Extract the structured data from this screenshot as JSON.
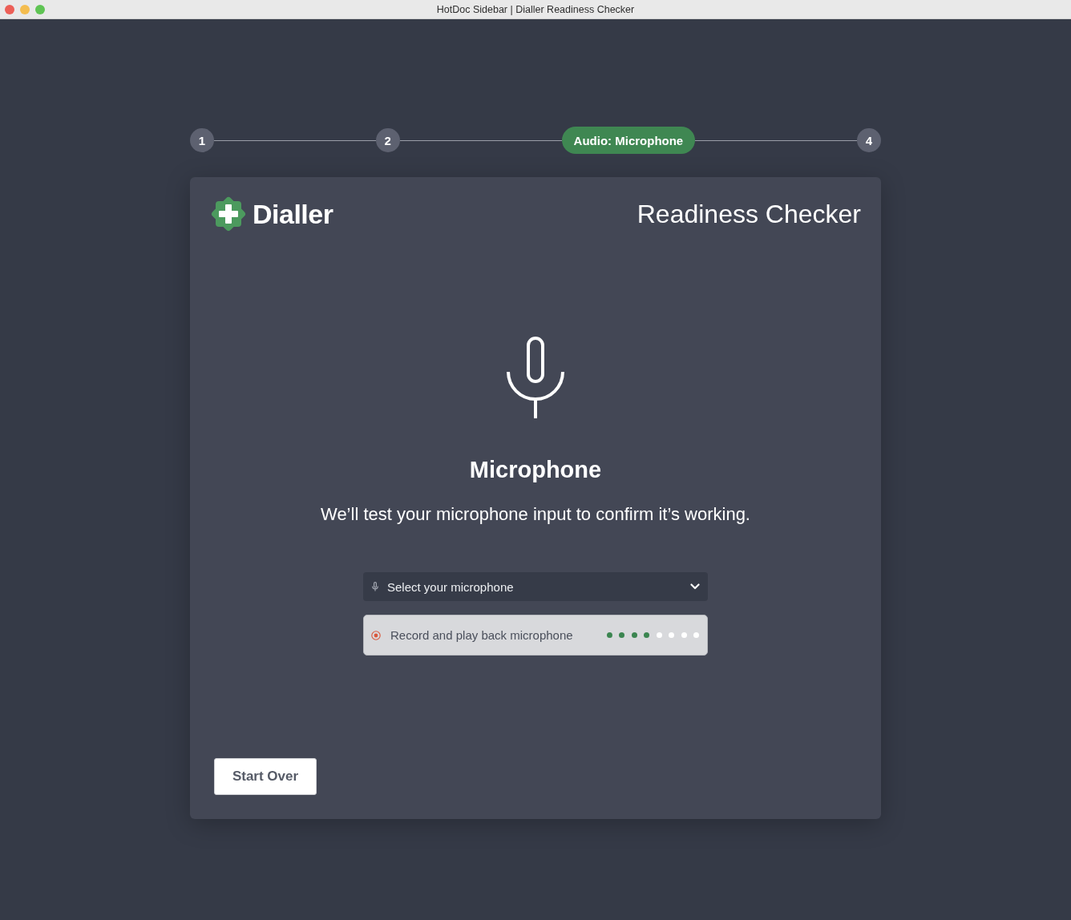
{
  "window": {
    "title": "HotDoc Sidebar | Dialler Readiness Checker"
  },
  "stepper": {
    "steps": [
      {
        "label": "1",
        "selected": false
      },
      {
        "label": "2",
        "selected": false
      },
      {
        "label": "Audio: Microphone",
        "selected": true
      },
      {
        "label": "4",
        "selected": false
      }
    ]
  },
  "header": {
    "brand": "Dialler",
    "title": "Readiness Checker"
  },
  "section": {
    "heading": "Microphone",
    "description": "We’ll test your microphone input to confirm it’s working."
  },
  "microphone_select": {
    "placeholder": "Select your microphone"
  },
  "recorder": {
    "label": "Record and play back microphone",
    "dots": [
      {
        "lit": true
      },
      {
        "lit": true
      },
      {
        "lit": true
      },
      {
        "lit": true
      },
      {
        "lit": false
      },
      {
        "lit": false
      },
      {
        "lit": false
      },
      {
        "lit": false
      }
    ]
  },
  "buttons": [
    {
      "label": "Start Over"
    }
  ]
}
